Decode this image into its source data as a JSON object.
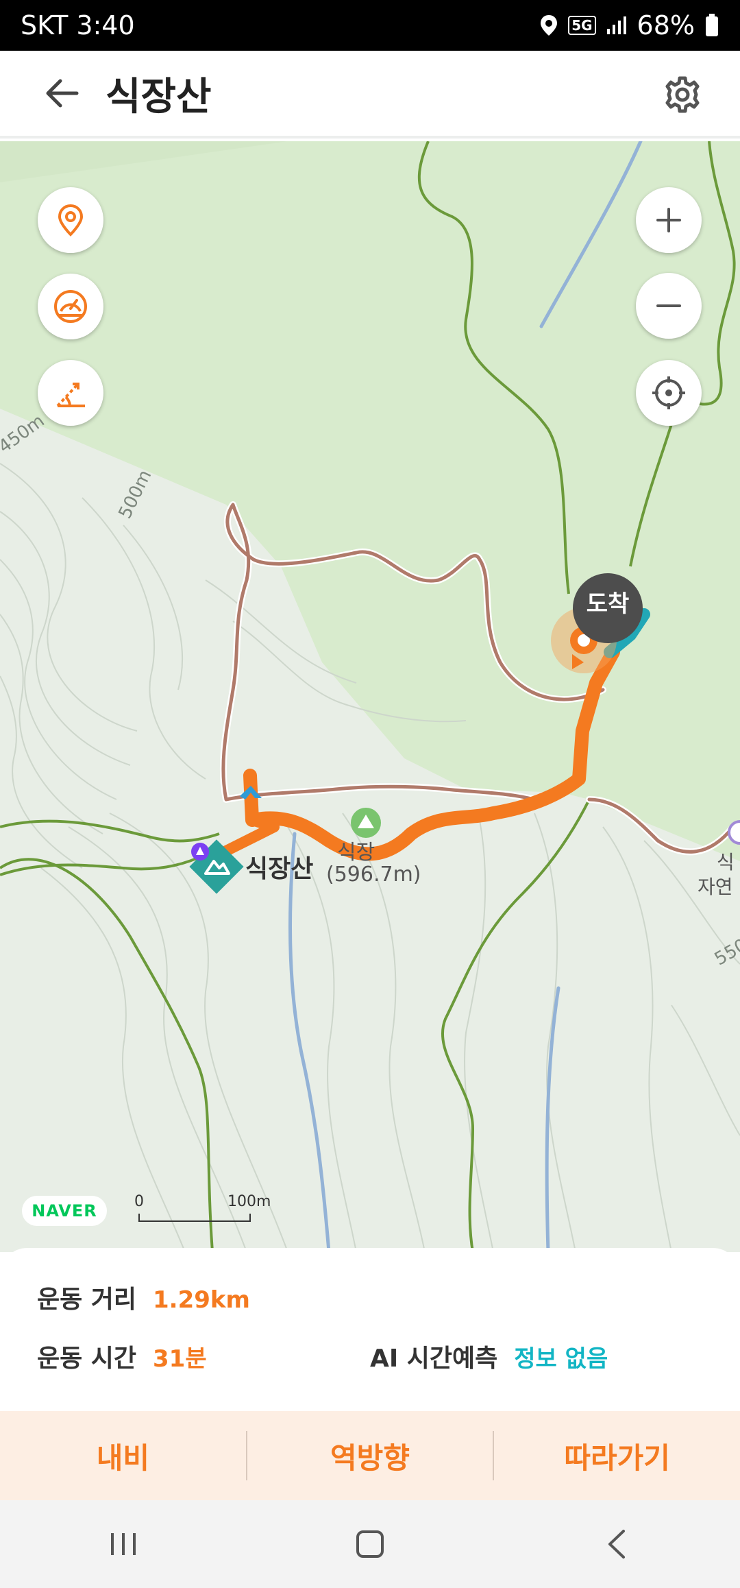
{
  "status_bar": {
    "carrier": "SKT",
    "time": "3:40",
    "network": "5G",
    "battery": "68%"
  },
  "header": {
    "title": "식장산",
    "back_icon": "arrow-left-icon",
    "settings_icon": "gear-icon"
  },
  "map": {
    "contour_labels": [
      "450m",
      "500m",
      "550"
    ],
    "peak_name": "식장산",
    "peak_elevation_text": "(596.7m)",
    "peak_poi_prefix": "식장",
    "edge_labels": [
      "식",
      "자연"
    ],
    "arrive_label": "도착",
    "naver_logo": "NAVER",
    "scale": {
      "start": "0",
      "end": "100m"
    },
    "left_buttons": [
      "location-pin-icon",
      "speedometer-icon",
      "slope-icon"
    ],
    "right_buttons": [
      "zoom-in-icon",
      "zoom-out-icon",
      "crosshair-icon"
    ],
    "colors": {
      "route": "#f47a20",
      "forest": "#d8ebcd",
      "terrain": "#e8eee6",
      "trail": "#b07a6a",
      "stream": "#93b2d6"
    }
  },
  "info": {
    "distance_label": "운동 거리",
    "distance_value": "1.29km",
    "time_label": "운동 시간",
    "time_value": "31분",
    "ai_label": "AI 시간예측",
    "ai_value": "정보 없음"
  },
  "actions": {
    "navi": "내비",
    "reverse": "역방향",
    "follow": "따라가기"
  },
  "navbar": [
    "recent-apps-icon",
    "home-icon",
    "back-icon"
  ]
}
